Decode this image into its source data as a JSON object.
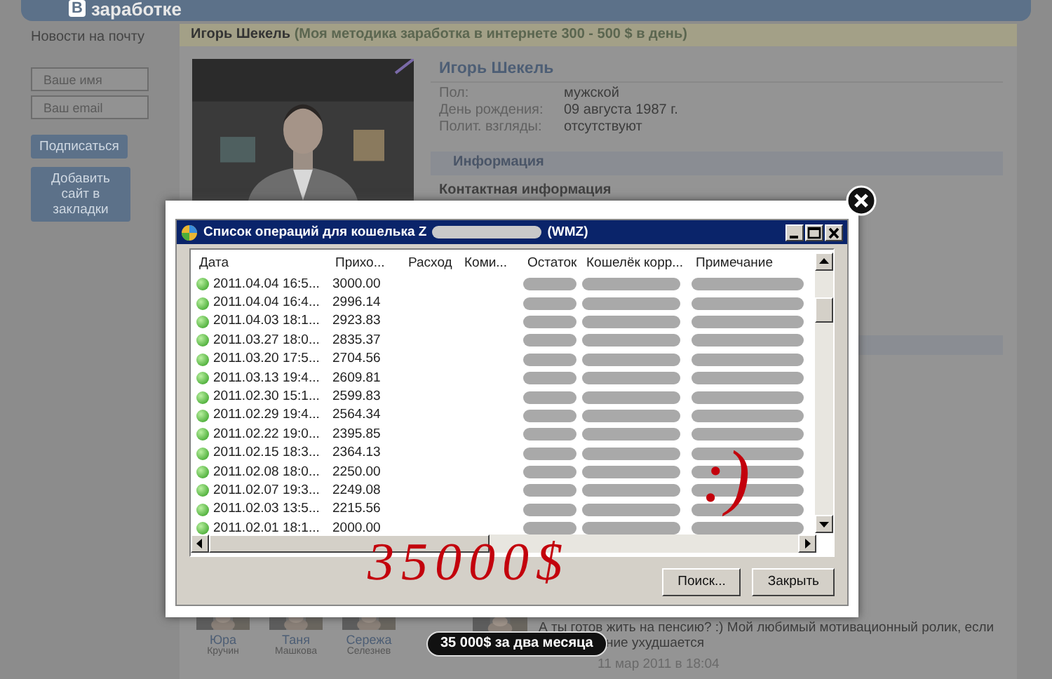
{
  "header": {
    "logo_letter": "В",
    "logo_text": "заработке"
  },
  "sidebar": {
    "heading": "Новости на почту",
    "fields": [
      {
        "placeholder": "Ваше имя"
      },
      {
        "placeholder": "Ваш email"
      }
    ],
    "buttons": [
      "Подписаться",
      "Добавить сайт в закладки"
    ]
  },
  "profile": {
    "banner_name": "Игорь Шекель",
    "banner_note": "(Моя методика заработка в интернете 300 - 500 $ в день)",
    "name": "Игорь Шекель",
    "fields": [
      {
        "label": "Пол:",
        "value": "мужской"
      },
      {
        "label": "День рождения:",
        "value": "09 августа 1987 г."
      },
      {
        "label": "Полит. взгляды:",
        "value": "отсутствуют"
      }
    ],
    "section": "Информация",
    "subsection": "Контактная информация"
  },
  "dialog": {
    "title": "Список операций для кошелька Z",
    "title_suffix": "(WMZ)",
    "columns": [
      "Дата",
      "Прихо...",
      "Расход",
      "Коми...",
      "Остаток",
      "Кошелёк корр...",
      "Примечание"
    ],
    "rows": [
      {
        "date": "2011.04.04 16:5...",
        "income": "3000.00"
      },
      {
        "date": "2011.04.04 16:4...",
        "income": "2996.14"
      },
      {
        "date": "2011.04.03 18:1...",
        "income": "2923.83"
      },
      {
        "date": "2011.03.27 18:0...",
        "income": "2835.37"
      },
      {
        "date": "2011.03.20 17:5...",
        "income": "2704.56"
      },
      {
        "date": "2011.03.13 19:4...",
        "income": "2609.81"
      },
      {
        "date": "2011.02.30 15:1...",
        "income": "2599.83"
      },
      {
        "date": "2011.02.29 19:4...",
        "income": "2564.34"
      },
      {
        "date": "2011.02.22 19:0...",
        "income": "2395.85"
      },
      {
        "date": "2011.02.15 18:3...",
        "income": "2364.13"
      },
      {
        "date": "2011.02.08 18:0...",
        "income": "2250.00"
      },
      {
        "date": "2011.02.07 19:3...",
        "income": "2249.08"
      },
      {
        "date": "2011.02.03 13:5...",
        "income": "2215.56"
      },
      {
        "date": "2011.02.01 18:1...",
        "income": "2000.00"
      }
    ],
    "buttons": [
      "Поиск...",
      "Закрыть"
    ]
  },
  "annotations": [
    {
      "kind": "amount",
      "text": "35000$"
    },
    {
      "kind": "smiley",
      "text": ":)"
    }
  ],
  "friends": [
    {
      "first": "Юра",
      "last": "Кручин"
    },
    {
      "first": "Таня",
      "last": "Машкова"
    },
    {
      "first": "Сережа",
      "last": "Селезнев"
    }
  ],
  "post": {
    "line1": "А ты готов жить на пенсию? :) Мой любимый мотивационный ролик, если",
    "line2": "ние ухудшается",
    "date": "11 мар 2011 в 18:04"
  },
  "tooltip": "35 000$ за два месяца"
}
